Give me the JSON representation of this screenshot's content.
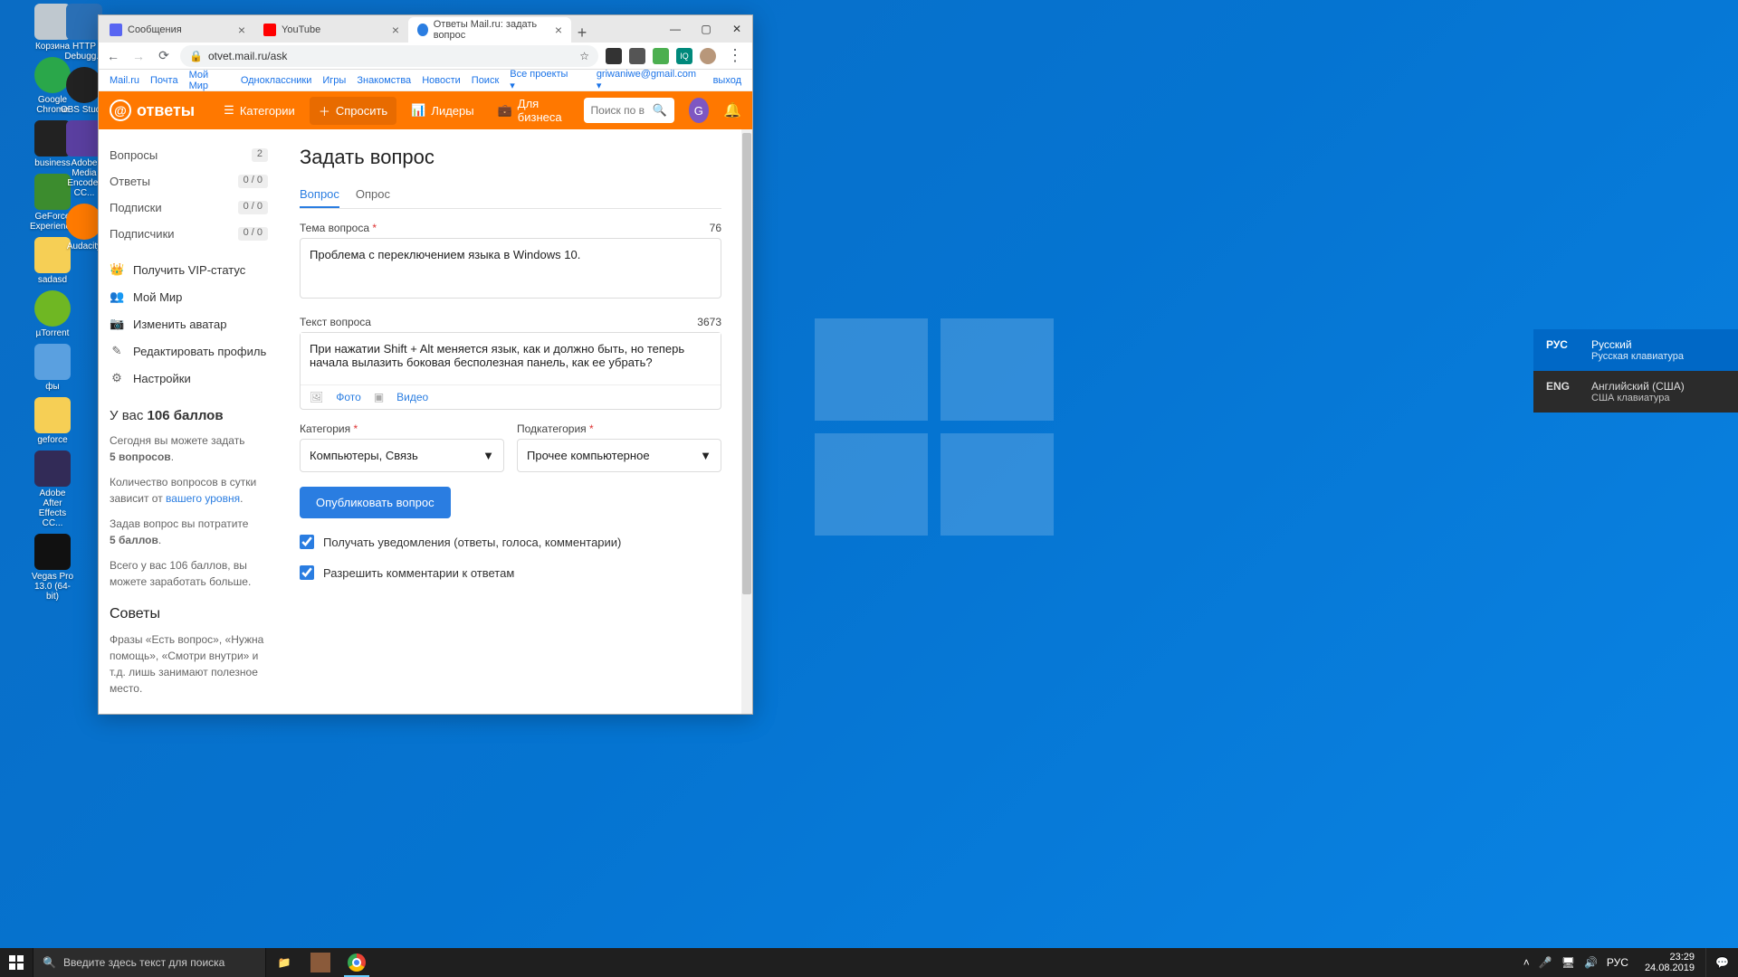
{
  "desktop": {
    "col1": [
      "Корзина",
      "Google Chrome",
      "business",
      "GeForce Experience",
      "sadasd",
      "µTorrent",
      "фы",
      "geforce",
      "Adobe After Effects CC...",
      "Vegas Pro 13.0 (64-bit)"
    ],
    "col2": [
      "HTTP Debugg...",
      "OBS Studio",
      "Adobe Media Encoder CC...",
      "Audacity"
    ]
  },
  "chrome": {
    "tabs": [
      "Сообщения",
      "YouTube",
      "Ответы Mail.ru: задать вопрос"
    ],
    "url": "otvet.mail.ru/ask",
    "userEmail": "griwaniwe@gmail.com",
    "logout": "выход"
  },
  "portal": [
    "Mail.ru",
    "Почта",
    "Мой Мир",
    "Одноклассники",
    "Игры",
    "Знакомства",
    "Новости",
    "Поиск",
    "Все проекты"
  ],
  "header": {
    "brand": "ответы",
    "nav": [
      "Категории",
      "Спросить",
      "Лидеры",
      "Для бизнеса"
    ],
    "searchPlaceholder": "Поиск по в",
    "avatarLetter": "G"
  },
  "sidebar": {
    "stats": [
      {
        "label": "Вопросы",
        "value": "2"
      },
      {
        "label": "Ответы",
        "value": "0 / 0"
      },
      {
        "label": "Подписки",
        "value": "0 / 0"
      },
      {
        "label": "Подписчики",
        "value": "0 / 0"
      }
    ],
    "links": [
      "Получить VIP-статус",
      "Мой Мир",
      "Изменить аватар",
      "Редактировать профиль",
      "Настройки"
    ],
    "scorePrefix": "У вас",
    "scoreValue": "106 баллов",
    "help1a": "Сегодня вы можете задать",
    "help1b": "5 вопросов",
    "help2a": "Количество вопросов в сутки зависит от",
    "help2link": "вашего уровня",
    "help3a": "Задав вопрос вы потратите",
    "help3b": "5 баллов",
    "help4": "Всего у вас 106 баллов, вы можете заработать больше.",
    "tipsHeading": "Советы",
    "tipsText": "Фразы «Есть вопрос», «Нужна помощь», «Смотри внутри» и т.д. лишь занимают полезное место."
  },
  "main": {
    "title": "Задать вопрос",
    "tabs": [
      "Вопрос",
      "Опрос"
    ],
    "topicLabel": "Тема вопроса",
    "topicCount": "76",
    "topicValue": "Проблема с переключением языка в Windows 10.",
    "textLabel": "Текст вопроса",
    "textCount": "3673",
    "textValue": "При нажатии Shift + Alt меняется язык, как и должно быть, но теперь начала вылазить боковая бесполезная панель, как ее убрать?",
    "attach": [
      "Фото",
      "Видео"
    ],
    "catLabel": "Категория",
    "catValue": "Компьютеры, Связь",
    "subcatLabel": "Подкатегория",
    "subcatValue": "Прочее компьютерное",
    "publish": "Опубликовать вопрос",
    "check1": "Получать уведомления (ответы, голоса, комментарии)",
    "check2": "Разрешить комментарии к ответам"
  },
  "lang": {
    "items": [
      {
        "code": "РУС",
        "name": "Русский",
        "kbd": "Русская клавиатура"
      },
      {
        "code": "ENG",
        "name": "Английский (США)",
        "kbd": "США клавиатура"
      }
    ]
  },
  "taskbar": {
    "searchPlaceholder": "Введите здесь текст для поиска",
    "lang": "РУС",
    "time": "23:29",
    "date": "24.08.2019"
  }
}
